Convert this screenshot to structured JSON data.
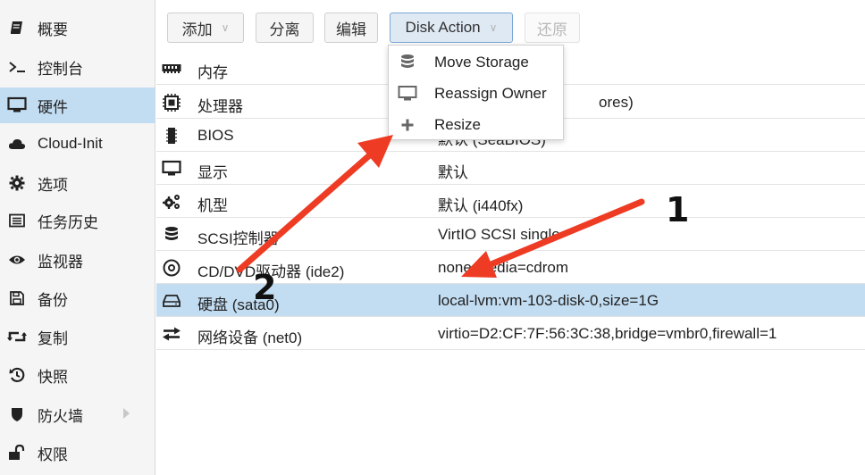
{
  "sidebar": {
    "items": [
      {
        "label": "概要",
        "icon": "book-icon"
      },
      {
        "label": "控制台",
        "icon": "terminal-icon"
      },
      {
        "label": "硬件",
        "icon": "monitor-icon"
      },
      {
        "label": "Cloud-Init",
        "icon": "cloud-icon"
      },
      {
        "label": "选项",
        "icon": "gear-icon"
      },
      {
        "label": "任务历史",
        "icon": "list-icon"
      },
      {
        "label": "监视器",
        "icon": "eye-icon"
      },
      {
        "label": "备份",
        "icon": "floppy-icon"
      },
      {
        "label": "复制",
        "icon": "retweet-icon"
      },
      {
        "label": "快照",
        "icon": "history-icon"
      },
      {
        "label": "防火墙",
        "icon": "shield-icon"
      },
      {
        "label": "权限",
        "icon": "unlock-icon"
      }
    ],
    "active_index": 2
  },
  "toolbar": {
    "add_label": "添加",
    "detach_label": "分离",
    "edit_label": "编辑",
    "disk_action_label": "Disk Action",
    "revert_label": "还原"
  },
  "hardware": {
    "rows": [
      {
        "label": "内存",
        "value": "",
        "icon": "memory-icon"
      },
      {
        "label": "处理器",
        "value": "ores)",
        "icon": "cpu-icon"
      },
      {
        "label": "BIOS",
        "value": "默认 (SeaBIOS)",
        "icon": "chip-icon"
      },
      {
        "label": "显示",
        "value": "默认",
        "icon": "display-icon"
      },
      {
        "label": "机型",
        "value": "默认 (i440fx)",
        "icon": "cogs-icon"
      },
      {
        "label": "SCSI控制器",
        "value": "VirtIO SCSI single",
        "icon": "database-icon"
      },
      {
        "label": "CD/DVD驱动器 (ide2)",
        "value": "none,media=cdrom",
        "icon": "cdrom-icon"
      },
      {
        "label": "硬盘 (sata0)",
        "value": "local-lvm:vm-103-disk-0,size=1G",
        "icon": "hdd-icon"
      },
      {
        "label": "网络设备 (net0)",
        "value": "virtio=D2:CF:7F:56:3C:38,bridge=vmbr0,firewall=1",
        "icon": "exchange-icon"
      }
    ],
    "selected_index": 7
  },
  "disk_action_menu": {
    "items": [
      {
        "label": "Move Storage",
        "icon": "database-icon"
      },
      {
        "label": "Reassign Owner",
        "icon": "desktop-icon"
      },
      {
        "label": "Resize",
        "icon": "plus-icon"
      }
    ]
  },
  "annotations": {
    "marker_1": "1",
    "marker_2": "2",
    "arrow_color": "#ee3b24"
  },
  "colors": {
    "selection": "#c2ddf2",
    "sidebar_bg": "#f5f5f5"
  }
}
